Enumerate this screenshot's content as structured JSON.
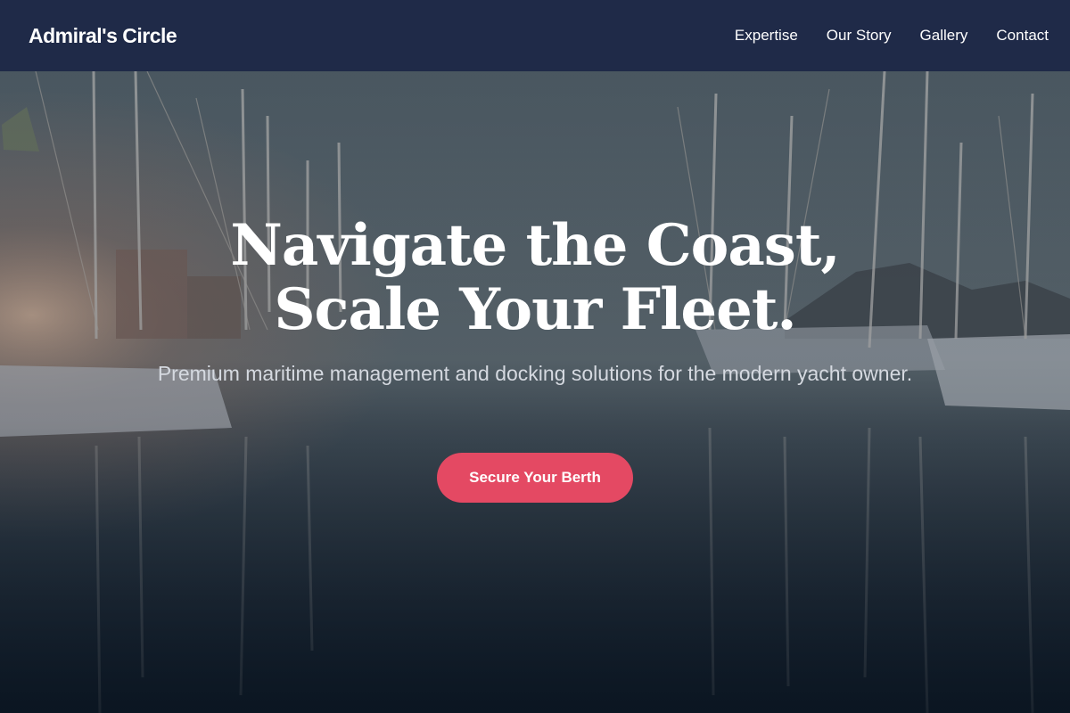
{
  "brand": {
    "name": "Admiral's Circle"
  },
  "nav": {
    "items": [
      {
        "label": "Expertise"
      },
      {
        "label": "Our Story"
      },
      {
        "label": "Gallery"
      },
      {
        "label": "Contact"
      }
    ]
  },
  "hero": {
    "headline_line1": "Navigate the Coast,",
    "headline_line2": "Scale Your Fleet.",
    "subheadline": "Premium maritime management and docking solutions for the modern yacht owner.",
    "cta_label": "Secure Your Berth",
    "background": "marina-sailboats-image"
  },
  "colors": {
    "navbar": "#1f2a48",
    "accent": "#e44963",
    "text": "#ffffff"
  }
}
